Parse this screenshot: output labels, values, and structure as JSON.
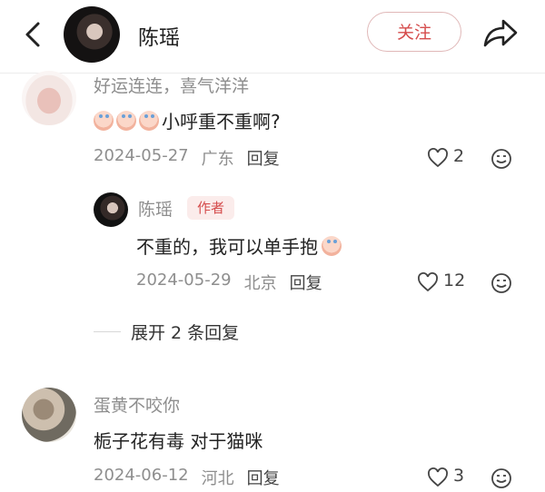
{
  "header": {
    "name": "陈瑶",
    "follow_label": "关注"
  },
  "comments": [
    {
      "user": "好运连连，喜气洋洋",
      "text": "小呼重不重啊?",
      "emoji_prefix_count": 3,
      "date": "2024-05-27",
      "location": "广东",
      "reply_label": "回复",
      "likes": "2"
    },
    {
      "user": "蛋黄不咬你",
      "text": "栀子花有毒 对于猫咪",
      "date": "2024-06-12",
      "location": "河北",
      "reply_label": "回复",
      "likes": "3"
    }
  ],
  "reply": {
    "user": "陈瑶",
    "badge": "作者",
    "text": "不重的，我可以单手抱",
    "date": "2024-05-29",
    "location": "北京",
    "reply_label": "回复",
    "likes": "12"
  },
  "expand_replies": "展开 2 条回复",
  "colors": {
    "accent": "#d54c4c",
    "muted": "#8e8e8e"
  },
  "icons": [
    "back-icon",
    "share-icon",
    "heart-icon",
    "smile-icon",
    "emoji-icon"
  ]
}
